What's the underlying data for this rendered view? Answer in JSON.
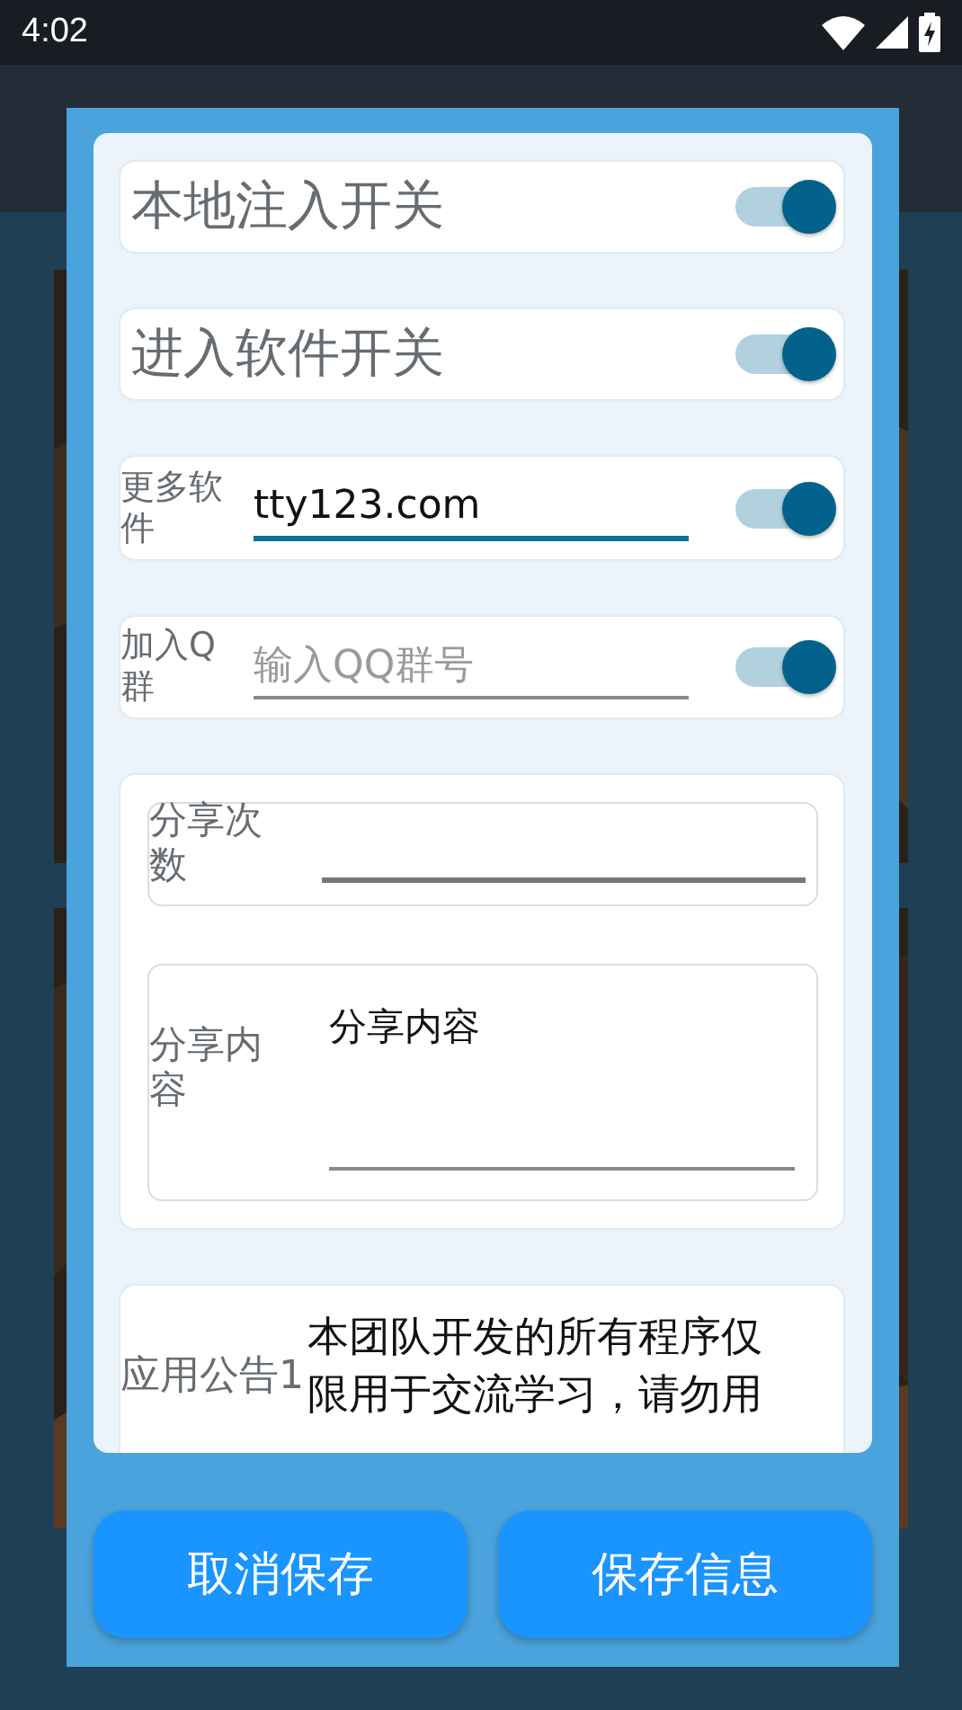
{
  "status_bar": {
    "time": "4:02"
  },
  "dialog": {
    "items": [
      {
        "kind": "switch",
        "label": "本地注入开关",
        "on": true
      },
      {
        "kind": "switch",
        "label": "进入软件开关",
        "on": true
      },
      {
        "kind": "field_switch",
        "label": "更多软件",
        "value": "tty123.com",
        "focused": true,
        "on": true
      },
      {
        "kind": "field_switch",
        "label": "加入Q群",
        "placeholder": "输入QQ群号",
        "focused": false,
        "on": true
      },
      {
        "kind": "group",
        "fields": [
          {
            "kind": "line",
            "label": "分享次数"
          },
          {
            "kind": "area",
            "label": "分享内容",
            "value": "分享内容"
          }
        ]
      },
      {
        "kind": "notice",
        "label": "应用公告1",
        "text": "本团队开发的所有程序仅限用于交流学习，请勿用"
      }
    ],
    "buttons": [
      {
        "label": "取消保存"
      },
      {
        "label": "保存信息"
      }
    ]
  }
}
